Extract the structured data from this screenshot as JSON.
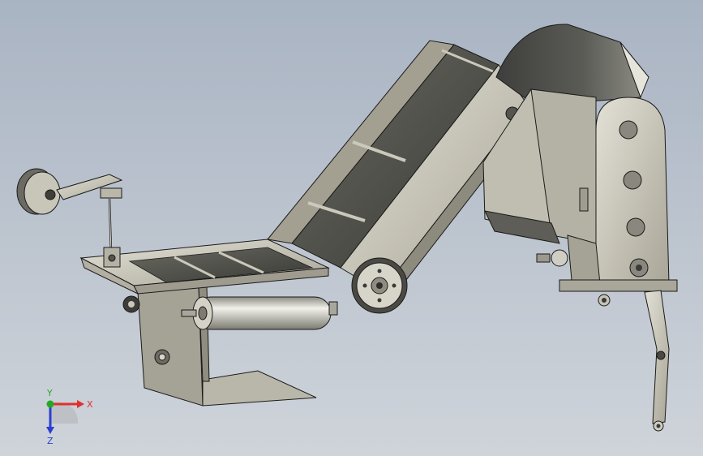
{
  "viewport": {
    "background_top": "#a9b4c3",
    "background_bottom": "#cfd4da",
    "part_color": "#cbc9bb",
    "edge_color": "#1a1a1a"
  },
  "triad": {
    "x_label": "X",
    "y_label": "Y",
    "z_label": "Z",
    "x_color": "#e03030",
    "y_color": "#22aa22",
    "z_color": "#2a3fd0"
  }
}
